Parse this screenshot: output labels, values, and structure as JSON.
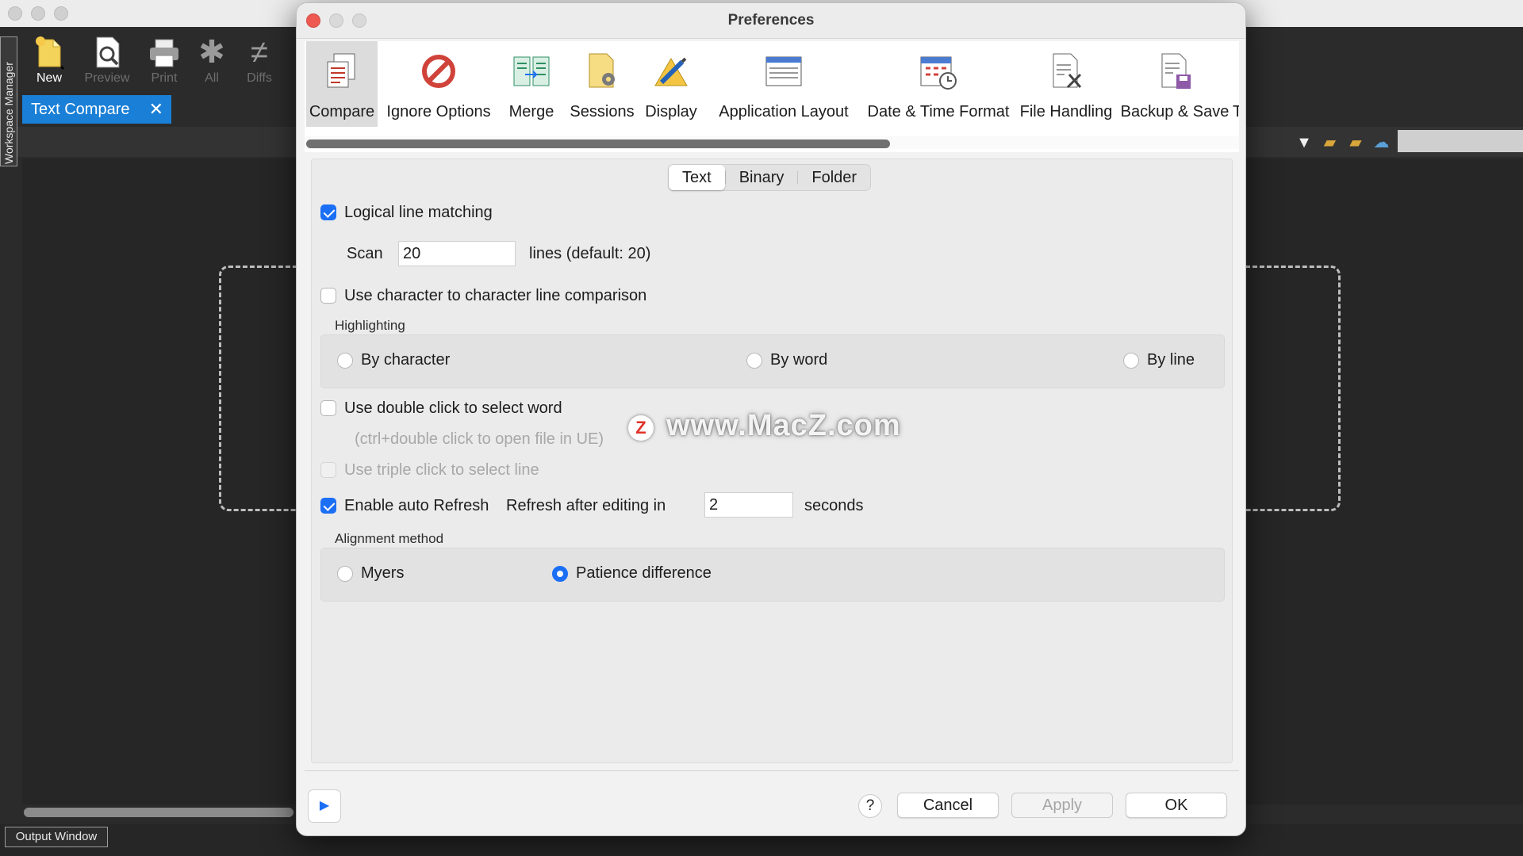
{
  "app": {
    "side_tab": "Workspace Manager",
    "toolbar": [
      {
        "label": "New",
        "icon": "new-document-icon"
      },
      {
        "label": "Preview",
        "icon": "preview-icon"
      },
      {
        "label": "Print",
        "icon": "print-icon"
      },
      {
        "label": "All",
        "icon": "asterisk-icon"
      },
      {
        "label": "Diffs",
        "icon": "not-equal-icon"
      }
    ],
    "doc_tab": "Text Compare",
    "output_tab": "Output Window"
  },
  "dialog": {
    "title": "Preferences",
    "categories": [
      {
        "label": "Compare",
        "icon": "compare-icon",
        "selected": true
      },
      {
        "label": "Ignore Options",
        "icon": "ignore-icon"
      },
      {
        "label": "Merge",
        "icon": "merge-icon"
      },
      {
        "label": "Sessions",
        "icon": "sessions-icon"
      },
      {
        "label": "Display",
        "icon": "display-icon"
      },
      {
        "label": "Application Layout",
        "icon": "layout-icon"
      },
      {
        "label": "Date & Time Format",
        "icon": "calendar-icon"
      },
      {
        "label": "File Handling",
        "icon": "file-handling-icon"
      },
      {
        "label": "Backup & Save",
        "icon": "backup-icon"
      },
      {
        "label": "T",
        "icon": ""
      }
    ],
    "subtabs": [
      "Text",
      "Binary",
      "Folder"
    ],
    "selected_subtab": "Text",
    "logical_line_matching": {
      "label": "Logical line matching",
      "checked": true
    },
    "scan": {
      "label": "Scan",
      "value": "20",
      "suffix": "lines (default: 20)"
    },
    "char_comparison": {
      "label": "Use character to character line comparison",
      "checked": false
    },
    "highlighting": {
      "label": "Highlighting",
      "options": [
        "By character",
        "By word",
        "By line"
      ],
      "selected": null
    },
    "double_click": {
      "label": "Use double click to select word",
      "checked": false,
      "hint": "(ctrl+double click to open file in UE)"
    },
    "triple_click": {
      "label": "Use triple click to select line",
      "checked": false,
      "disabled": true
    },
    "auto_refresh": {
      "label": "Enable auto Refresh",
      "checked": true,
      "refresh_label": "Refresh after editing in",
      "value": "2",
      "unit": "seconds"
    },
    "alignment": {
      "label": "Alignment method",
      "options": [
        "Myers",
        "Patience difference"
      ],
      "selected": "Patience difference"
    },
    "buttons": {
      "help": "?",
      "cancel": "Cancel",
      "apply": "Apply",
      "ok": "OK"
    }
  },
  "watermark": {
    "logo": "Z",
    "text": "www.MacZ.com"
  },
  "colors": {
    "accent": "#1b6ff5",
    "doc_tab": "#1a7fd6",
    "close_dot": "#ee5a52"
  }
}
